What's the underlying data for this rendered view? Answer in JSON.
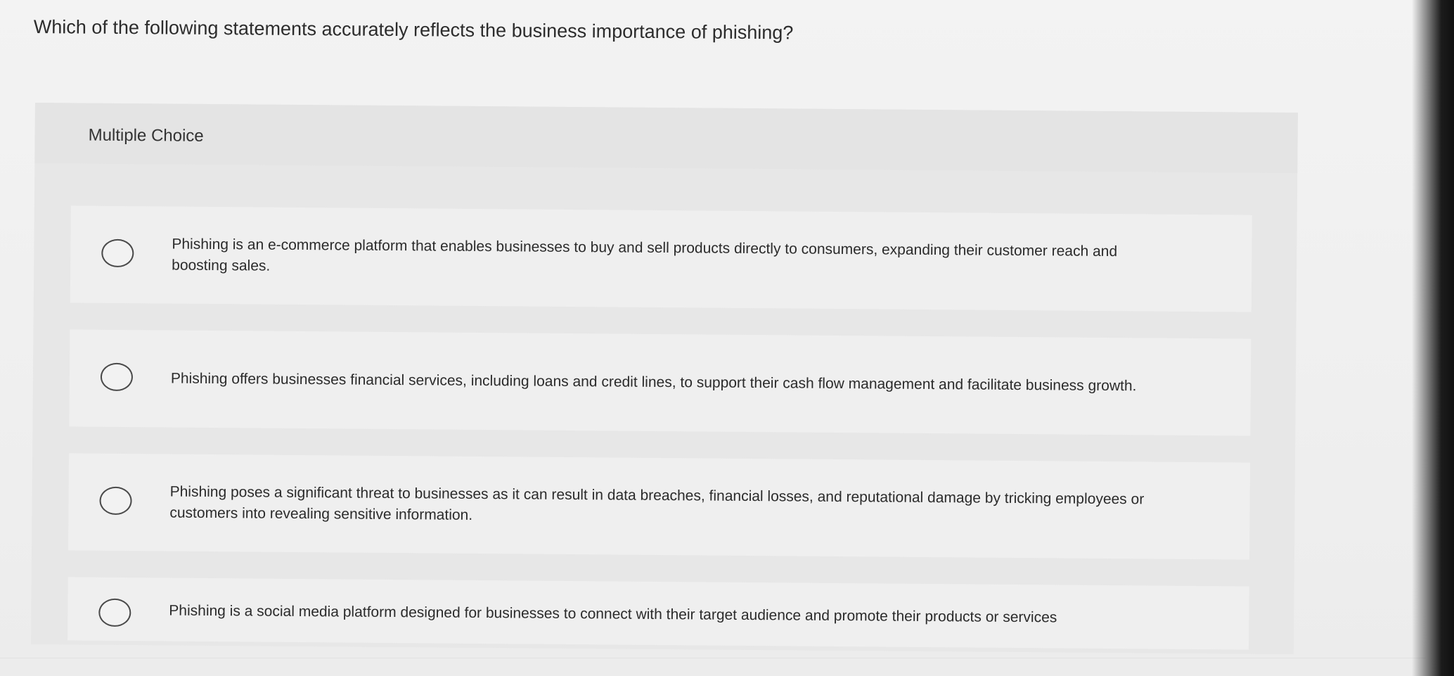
{
  "question": {
    "text": "Which of the following statements accurately reflects the business importance of phishing?"
  },
  "panel": {
    "title": "Multiple Choice"
  },
  "choices": [
    {
      "text": "Phishing is an e-commerce platform that enables businesses to buy and sell products directly to consumers, expanding their customer reach and boosting sales."
    },
    {
      "text": "Phishing offers businesses financial services, including loans and credit lines, to support their cash flow management and facilitate business growth."
    },
    {
      "text": "Phishing poses a significant threat to businesses as it can result in data breaches, financial losses, and reputational damage by tricking employees or customers into revealing sensitive information."
    },
    {
      "text": "Phishing is a social media platform designed for businesses to connect with their target audience and promote their products or services"
    }
  ],
  "colors": {
    "background": "#f0f0f0",
    "panel": "#e7e7e7",
    "choice": "#efefef",
    "text": "#2b2b2b",
    "radio_border": "#4a4a4a"
  }
}
